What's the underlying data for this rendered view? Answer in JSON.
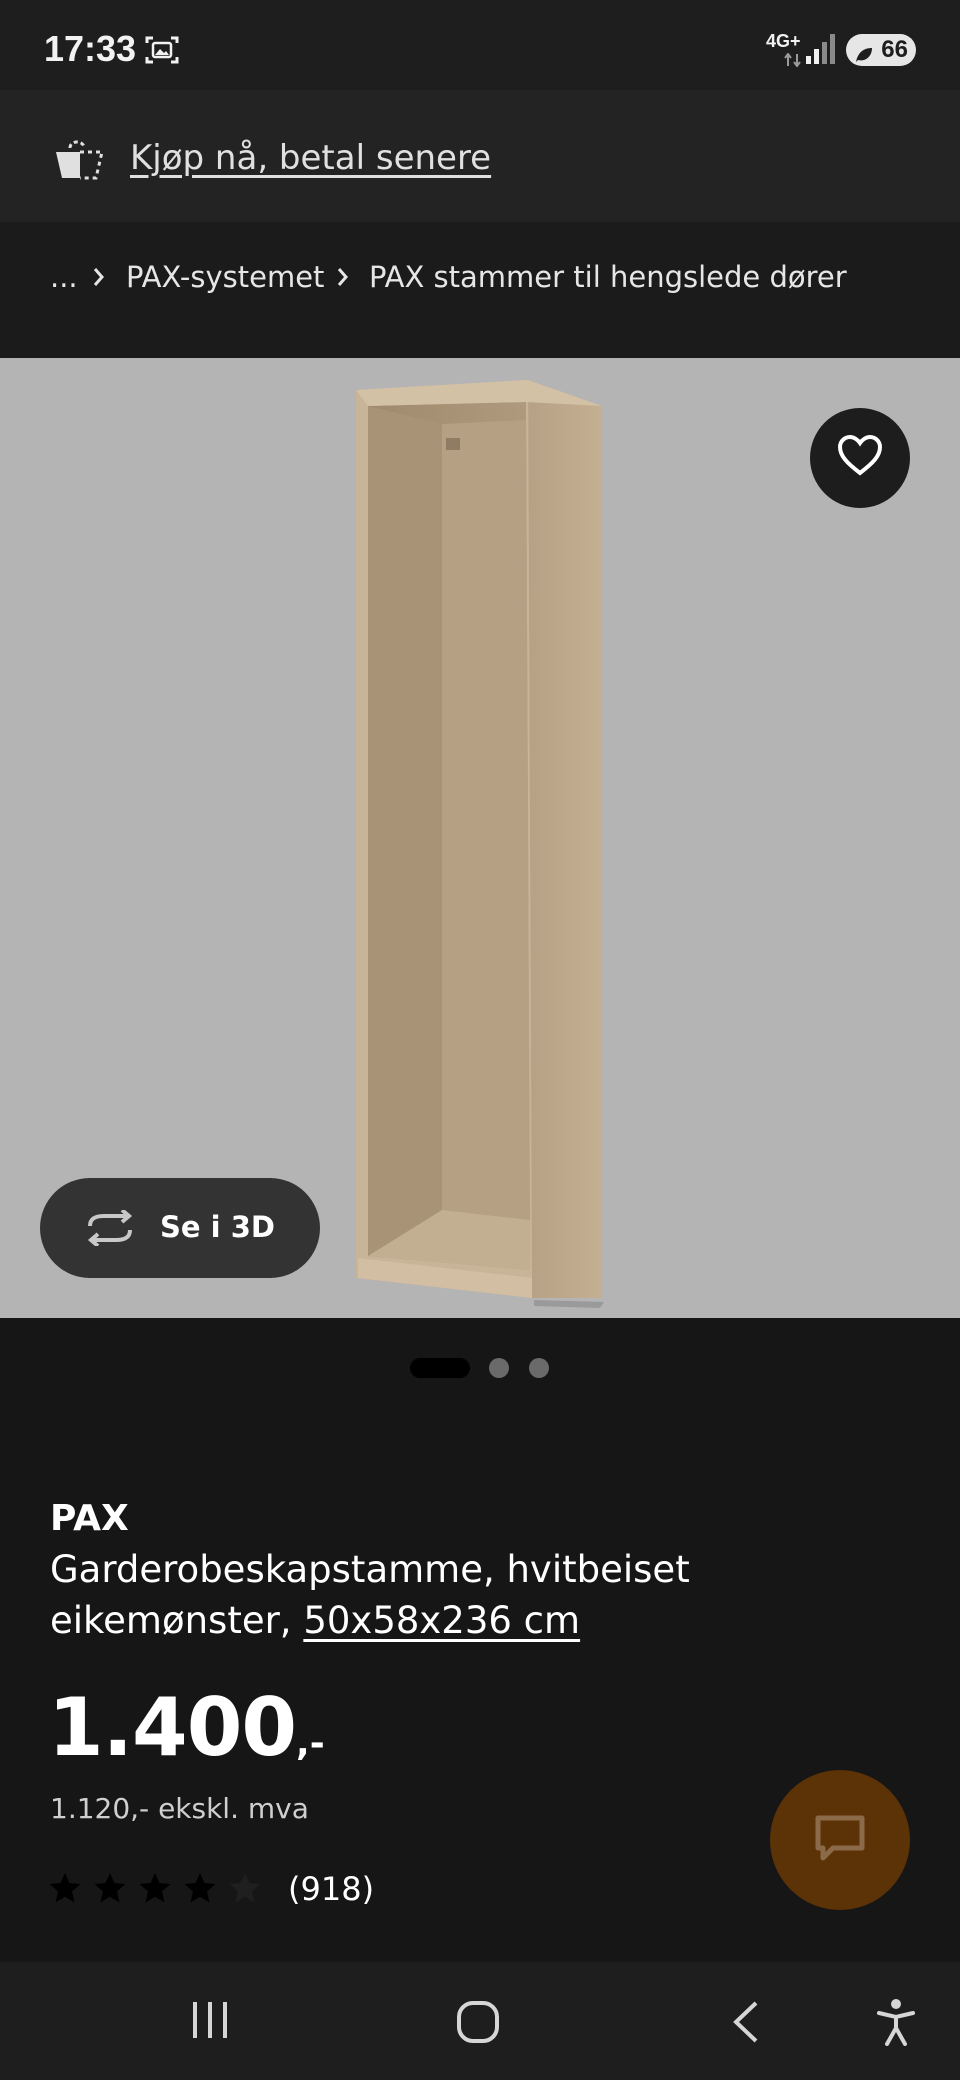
{
  "status_bar": {
    "time": "17:33",
    "network": "4G+",
    "battery": "66"
  },
  "promo": {
    "link_text": "Kjøp nå, betal senere"
  },
  "breadcrumb": {
    "ellipsis": "...",
    "items": [
      "PAX-systemet",
      "PAX stammer til hengslede dører"
    ]
  },
  "gallery": {
    "view_3d_label": "Se i 3D",
    "image_count": 3,
    "active_index": 0
  },
  "product": {
    "name": "PAX",
    "description": "Garderobeskapstamme, hvitbeiset eikemønster,",
    "size": "50x58x236 cm",
    "price": "1.400",
    "price_suffix": ",-",
    "price_ex_vat": "1.120,- ekskl. mva",
    "rating": 4,
    "rating_max": 5,
    "review_count": "(918)"
  },
  "colors": {
    "background": "#161617",
    "image_bg": "#b4b4b4",
    "chat_button": "#5c3207"
  },
  "icons": {
    "favorite": "heart-icon",
    "view_3d": "rotate-icon",
    "chat": "chat-icon",
    "nav": [
      "recent-apps-icon",
      "home-icon",
      "back-icon",
      "accessibility-icon"
    ]
  }
}
